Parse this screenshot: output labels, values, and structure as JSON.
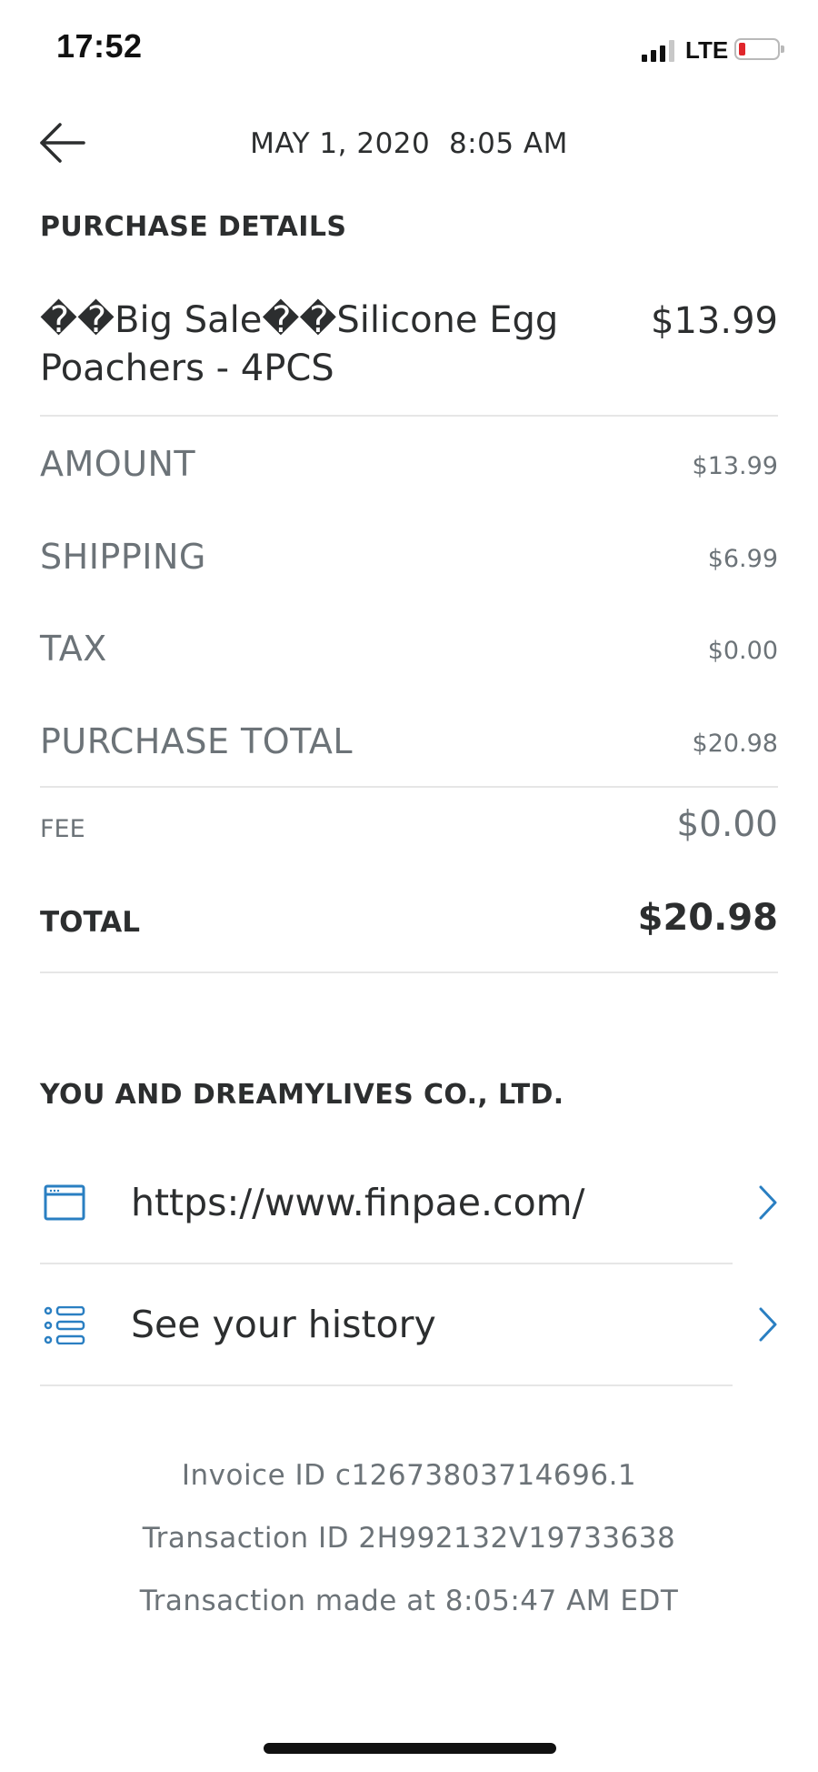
{
  "status_bar": {
    "time": "17:52",
    "network": "LTE",
    "battery_level": 0.15,
    "battery_color": "#e0262b"
  },
  "header": {
    "back_icon": "arrow-left-icon",
    "date_time": "MAY 1, 2020  8:05 AM"
  },
  "purchase_details": {
    "title": "PURCHASE DETAILS",
    "item": {
      "name": "��Big Sale��Silicone Egg Poachers - 4PCS",
      "price": "$13.99"
    },
    "rows": [
      {
        "label": "AMOUNT",
        "value": "$13.99"
      },
      {
        "label": "SHIPPING",
        "value": "$6.99"
      },
      {
        "label": "TAX",
        "value": "$0.00"
      },
      {
        "label": "PURCHASE TOTAL",
        "value": "$20.98"
      }
    ],
    "fee": {
      "label": "FEE",
      "value": "$0.00"
    },
    "total": {
      "label": "TOTAL",
      "value": "$20.98"
    }
  },
  "merchant": {
    "title": "YOU AND DREAMYLIVES CO., LTD.",
    "links": [
      {
        "icon": "browser-window-icon",
        "text": "https://www.finpae.com/"
      },
      {
        "icon": "list-icon",
        "text": "See your history"
      }
    ],
    "accent_color": "#2a7fc2"
  },
  "footer": {
    "invoice_id": "Invoice ID c12673803714696.1",
    "transaction_id": "Transaction ID 2H992132V19733638",
    "transaction_time": "Transaction made at 8:05:47 AM EDT"
  }
}
